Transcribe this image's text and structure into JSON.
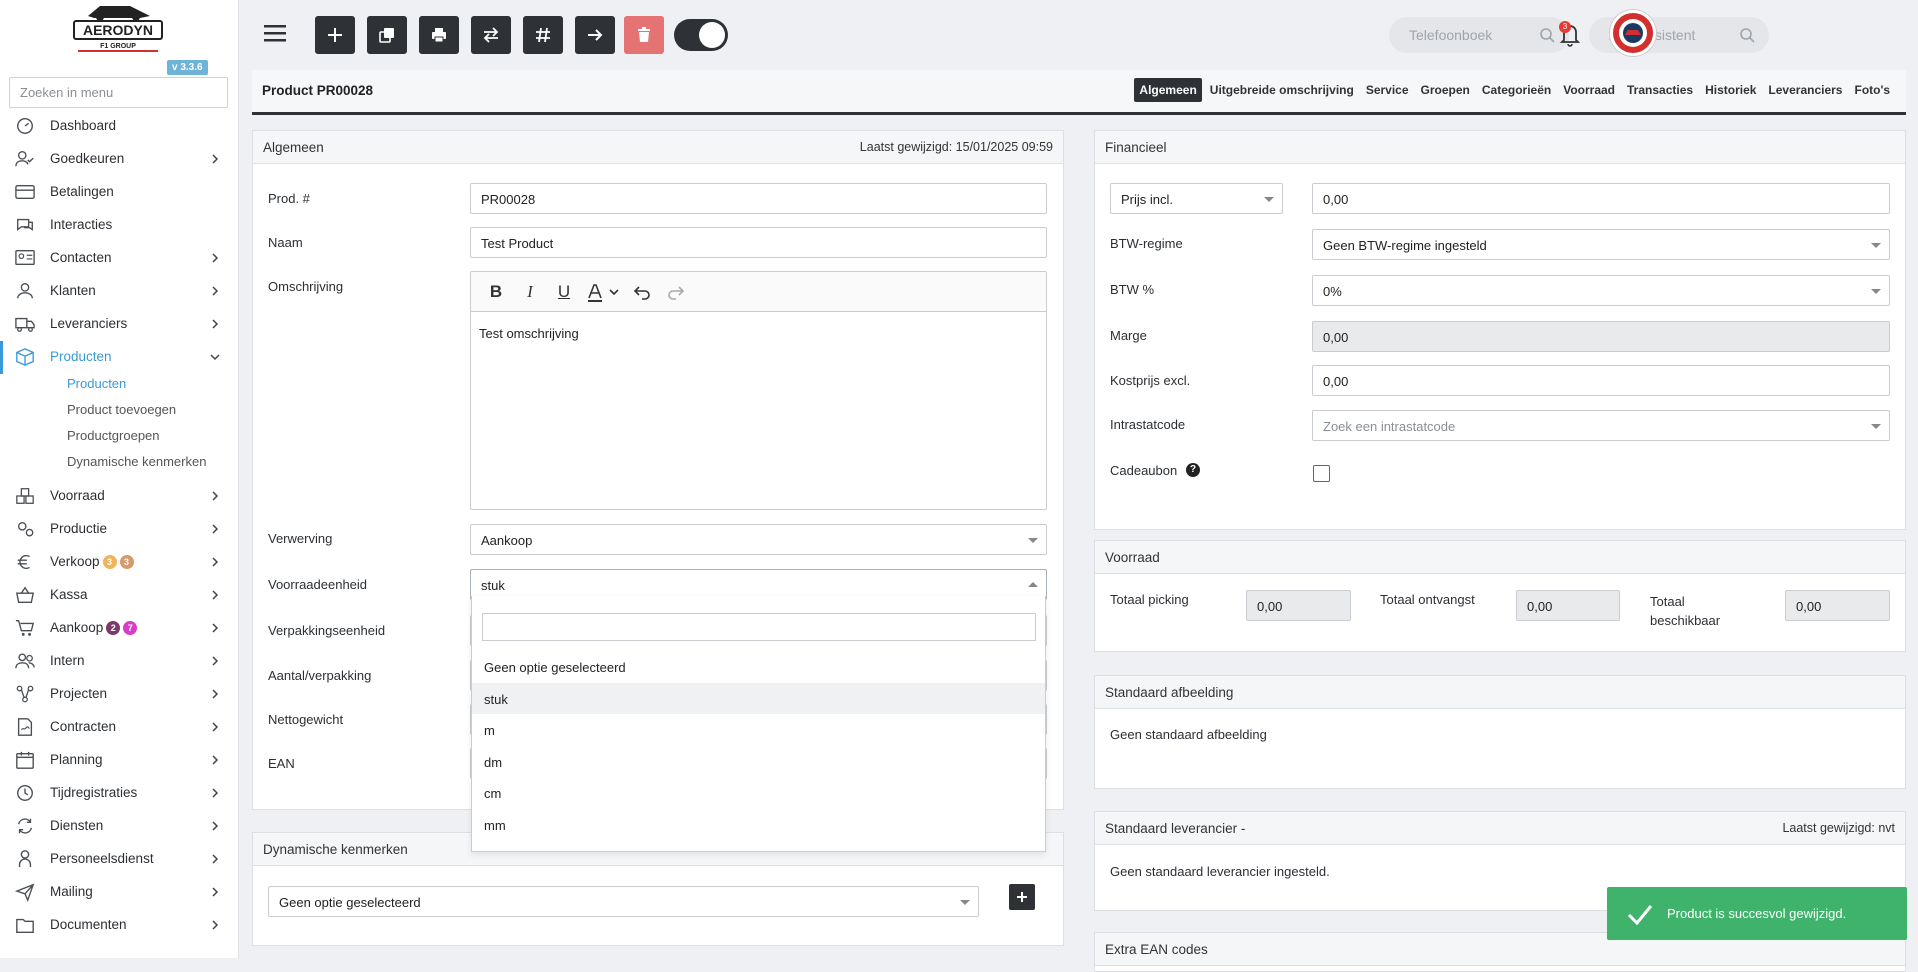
{
  "sidebar": {
    "version": "v 3.3.6",
    "search_placeholder": "Zoeken in menu",
    "items": [
      {
        "label": "Dashboard"
      },
      {
        "label": "Goedkeuren"
      },
      {
        "label": "Betalingen"
      },
      {
        "label": "Interacties"
      },
      {
        "label": "Contacten"
      },
      {
        "label": "Klanten"
      },
      {
        "label": "Leveranciers"
      },
      {
        "label": "Producten"
      },
      {
        "label": "Voorraad"
      },
      {
        "label": "Productie"
      },
      {
        "label": "Verkoop",
        "badges": [
          "3",
          "3"
        ]
      },
      {
        "label": "Kassa"
      },
      {
        "label": "Aankoop",
        "badges": [
          "7",
          "2"
        ]
      },
      {
        "label": "Intern"
      },
      {
        "label": "Projecten"
      },
      {
        "label": "Contracten"
      },
      {
        "label": "Planning"
      },
      {
        "label": "Tijdregistraties"
      },
      {
        "label": "Diensten"
      },
      {
        "label": "Personeelsdienst"
      },
      {
        "label": "Mailing"
      },
      {
        "label": "Documenten"
      }
    ],
    "sub_items": [
      "Producten",
      "Product toevoegen",
      "Productgroepen",
      "Dynamische kenmerken"
    ],
    "badge_colors": {
      "orange1": "#d59b6a",
      "orange2": "#f0b45a",
      "magenta": "#d63ec9",
      "purple": "#7b3a6a"
    }
  },
  "topbar": {
    "phonebook_placeholder": "Telefoonboek",
    "search_placeholder": "Zoekassistent",
    "notification_count": "3"
  },
  "page": {
    "title": "Product PR00028",
    "tabs": [
      "Algemeen",
      "Uitgebreide omschrijving",
      "Service",
      "Groepen",
      "Categorieën",
      "Voorraad",
      "Transacties",
      "Historiek",
      "Leveranciers",
      "Foto's"
    ]
  },
  "algemeen": {
    "title": "Algemeen",
    "last_modified": "Laatst gewijzigd: 15/01/2025 09:59",
    "prod_label": "Prod. #",
    "prod_value": "PR00028",
    "naam_label": "Naam",
    "naam_value": "Test Product",
    "omschrijving_label": "Omschrijving",
    "omschrijving_value": "Test omschrijving",
    "verwerving_label": "Verwerving",
    "verwerving_value": "Aankoop",
    "voorraadeenheid_label": "Voorraadeenheid",
    "voorraadeenheid_value": "stuk",
    "verpakkingseenheid_label": "Verpakkingseenheid",
    "aantal_label": "Aantal/verpakking",
    "nettogewicht_label": "Nettogewicht",
    "ean_label": "EAN"
  },
  "dropdown": {
    "options": [
      "Geen optie geselecteerd",
      "stuk",
      "m",
      "dm",
      "cm",
      "mm"
    ]
  },
  "dynamische": {
    "title": "Dynamische kenmerken",
    "select_value": "Geen optie geselecteerd"
  },
  "financieel": {
    "title": "Financieel",
    "prijs_select": "Prijs incl.",
    "prijs_value": "0,00",
    "btw_regime_label": "BTW-regime",
    "btw_regime_value": "Geen BTW-regime ingesteld",
    "btw_pct_label": "BTW %",
    "btw_pct_value": "0%",
    "marge_label": "Marge",
    "marge_value": "0,00",
    "kostprijs_label": "Kostprijs excl.",
    "kostprijs_value": "0,00",
    "intrastat_label": "Intrastatcode",
    "intrastat_placeholder": "Zoek een intrastatcode",
    "cadeaubon_label": "Cadeaubon"
  },
  "voorraad": {
    "title": "Voorraad",
    "picking_label": "Totaal picking",
    "picking_value": "0,00",
    "ontvangst_label": "Totaal ontvangst",
    "ontvangst_value": "0,00",
    "beschikbaar_label": "Totaal beschikbaar",
    "beschikbaar_value": "0,00"
  },
  "afbeelding": {
    "title": "Standaard afbeelding",
    "text": "Geen standaard afbeelding"
  },
  "leverancier": {
    "title": "Standaard leverancier -",
    "last_modified": "Laatst gewijzigd: nvt",
    "text": "Geen standaard leverancier ingesteld."
  },
  "extra_ean": {
    "title": "Extra EAN codes"
  },
  "toast": {
    "text": "Product is succesvol gewijzigd."
  }
}
